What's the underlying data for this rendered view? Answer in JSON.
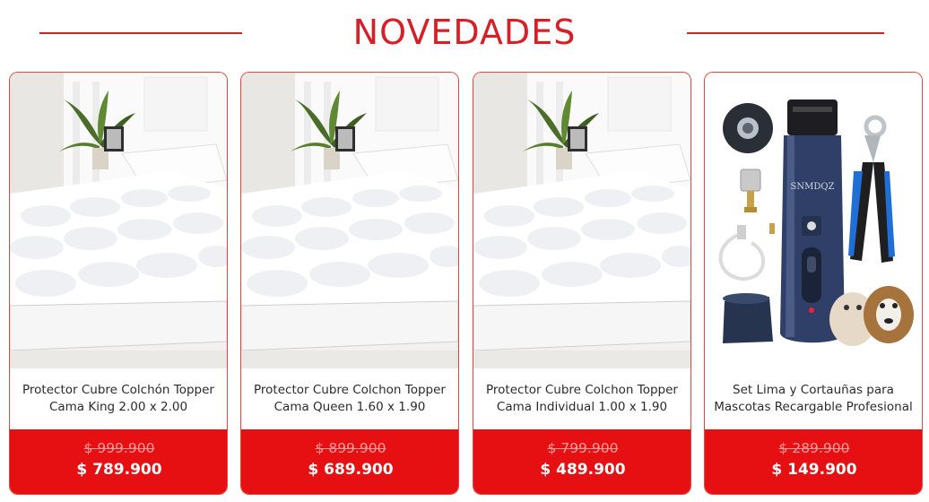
{
  "section": {
    "title": "NOVEDADES"
  },
  "colors": {
    "accent": "#d61f26",
    "price_bg": "#e60f12",
    "old_price": "#ff9b9b"
  },
  "products": [
    {
      "name": "Protector Cubre Colchón Topper Cama King 2.00 x 2.00",
      "old_price": "$ 999.900",
      "price": "$ 789.900",
      "image": "mattress-topper"
    },
    {
      "name": "Protector Cubre Colchon Topper Cama Queen 1.60 x 1.90",
      "old_price": "$ 899.900",
      "price": "$ 689.900",
      "image": "mattress-topper"
    },
    {
      "name": "Protector Cubre Colchon Topper Cama Individual 1.00 x 1.90",
      "old_price": "$ 799.900",
      "price": "$ 489.900",
      "image": "mattress-topper"
    },
    {
      "name": "Set Lima y Cortauñas para Mascotas Recargable Profesional",
      "old_price": "$ 289.900",
      "price": "$ 149.900",
      "image": "pet-nail-grinder",
      "brand_text": "SNMDQZ"
    }
  ]
}
